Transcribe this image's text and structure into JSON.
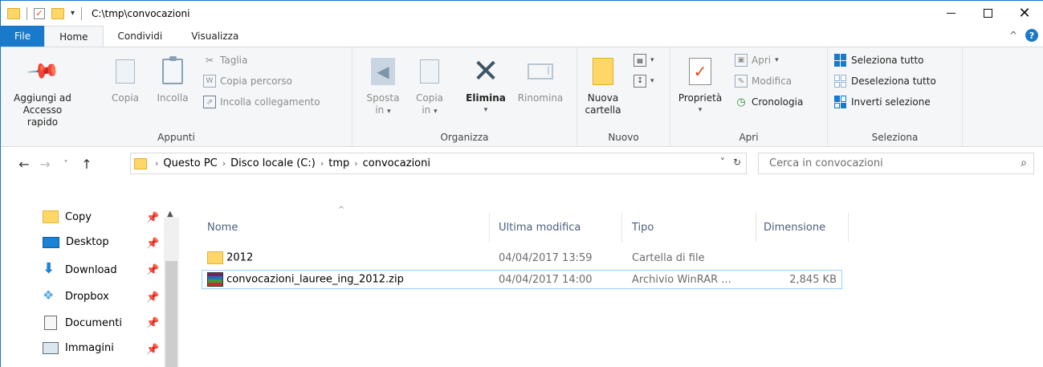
{
  "window": {
    "title": "C:\\tmp\\convocazioni"
  },
  "tabs": [
    {
      "label": "File"
    },
    {
      "label": "Home"
    },
    {
      "label": "Condividi"
    },
    {
      "label": "Visualizza"
    }
  ],
  "ribbon": {
    "appunti": {
      "label": "Appunti",
      "pin_line1": "Aggiungi ad",
      "pin_line2": "Accesso rapido",
      "copia": "Copia",
      "incolla": "Incolla",
      "taglia": "Taglia",
      "copia_percorso": "Copia percorso",
      "incolla_collegamento": "Incolla collegamento"
    },
    "organizza": {
      "label": "Organizza",
      "sposta_line1": "Sposta",
      "sposta_line2": "in",
      "copia_line1": "Copia",
      "copia_line2": "in",
      "elimina": "Elimina",
      "rinomina": "Rinomina"
    },
    "nuovo": {
      "label": "Nuovo",
      "nuova_line1": "Nuova",
      "nuova_line2": "cartella"
    },
    "apri": {
      "label": "Apri",
      "proprieta": "Proprietà",
      "apri": "Apri",
      "modifica": "Modifica",
      "cronologia": "Cronologia"
    },
    "seleziona": {
      "label": "Seleziona",
      "seleziona_tutto": "Seleziona tutto",
      "deseleziona_tutto": "Deseleziona tutto",
      "inverti_selezione": "Inverti selezione"
    }
  },
  "address": {
    "crumbs": [
      "Questo PC",
      "Disco locale (C:)",
      "tmp",
      "convocazioni"
    ],
    "search_placeholder": "Cerca in convocazioni"
  },
  "nav_pane": {
    "items": [
      {
        "label": "Copy",
        "icon": "folder-icon"
      },
      {
        "label": "Desktop",
        "icon": "desktop-icon"
      },
      {
        "label": "Download",
        "icon": "download-icon"
      },
      {
        "label": "Dropbox",
        "icon": "dropbox-icon"
      },
      {
        "label": "Documenti",
        "icon": "documents-icon"
      },
      {
        "label": "Immagini",
        "icon": "pictures-icon"
      }
    ]
  },
  "file_list": {
    "columns": [
      "Nome",
      "Ultima modifica",
      "Tipo",
      "Dimensione"
    ],
    "rows": [
      {
        "name": "2012",
        "modified": "04/04/2017 13:59",
        "type": "Cartella di file",
        "size": "",
        "icon": "folder-icon"
      },
      {
        "name": "convocazioni_lauree_ing_2012.zip",
        "modified": "04/04/2017 14:00",
        "type": "Archivio WinRAR ...",
        "size": "2,845 KB",
        "icon": "winrar-archive-icon"
      }
    ]
  },
  "colors": {
    "accent": "#1979ca",
    "folder": "#ffd766",
    "selection_border": "#99d1ff"
  }
}
